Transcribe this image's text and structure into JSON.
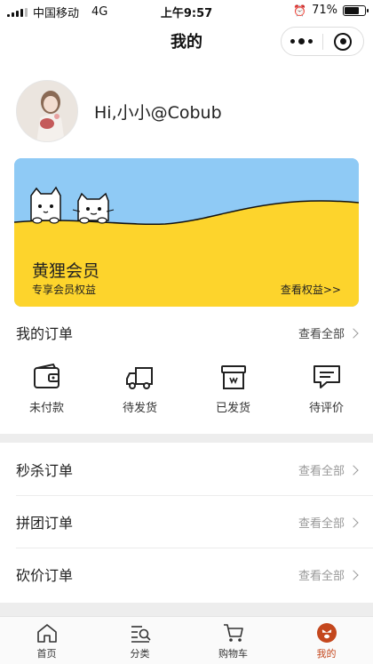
{
  "status_bar": {
    "carrier": "中国移动",
    "network": "4G",
    "time": "上午9:57",
    "battery": "71%",
    "battery_level": 0.71
  },
  "nav": {
    "title": "我的",
    "more_icon": "more-dots-icon",
    "close_icon": "mini-program-close-icon"
  },
  "profile": {
    "greeting": "Hi,小小@Cobub"
  },
  "member_card": {
    "title": "黄狸会员",
    "subtitle": "专享会员权益",
    "link": "查看权益>>",
    "colors": {
      "sky": "#8fcaf5",
      "ground": "#fdd42c"
    }
  },
  "my_orders": {
    "label": "我的订单",
    "view_all": "查看全部",
    "items": [
      {
        "label": "未付款",
        "icon": "wallet-icon"
      },
      {
        "label": "待发货",
        "icon": "truck-icon"
      },
      {
        "label": "已发货",
        "icon": "package-box-icon"
      },
      {
        "label": "待评价",
        "icon": "comment-icon"
      }
    ]
  },
  "flash_orders": {
    "label": "秒杀订单",
    "view_all": "查看全部"
  },
  "group_orders": {
    "label": "拼团订单",
    "view_all": "查看全部"
  },
  "bargain_orders": {
    "label": "砍价订单",
    "view_all": "查看全部"
  },
  "tabbar": {
    "items": [
      {
        "label": "首页",
        "icon": "home-icon"
      },
      {
        "label": "分类",
        "icon": "category-search-icon"
      },
      {
        "label": "购物车",
        "icon": "cart-icon"
      },
      {
        "label": "我的",
        "icon": "profile-face-icon",
        "active": true
      }
    ],
    "active_color": "#c4471d"
  }
}
